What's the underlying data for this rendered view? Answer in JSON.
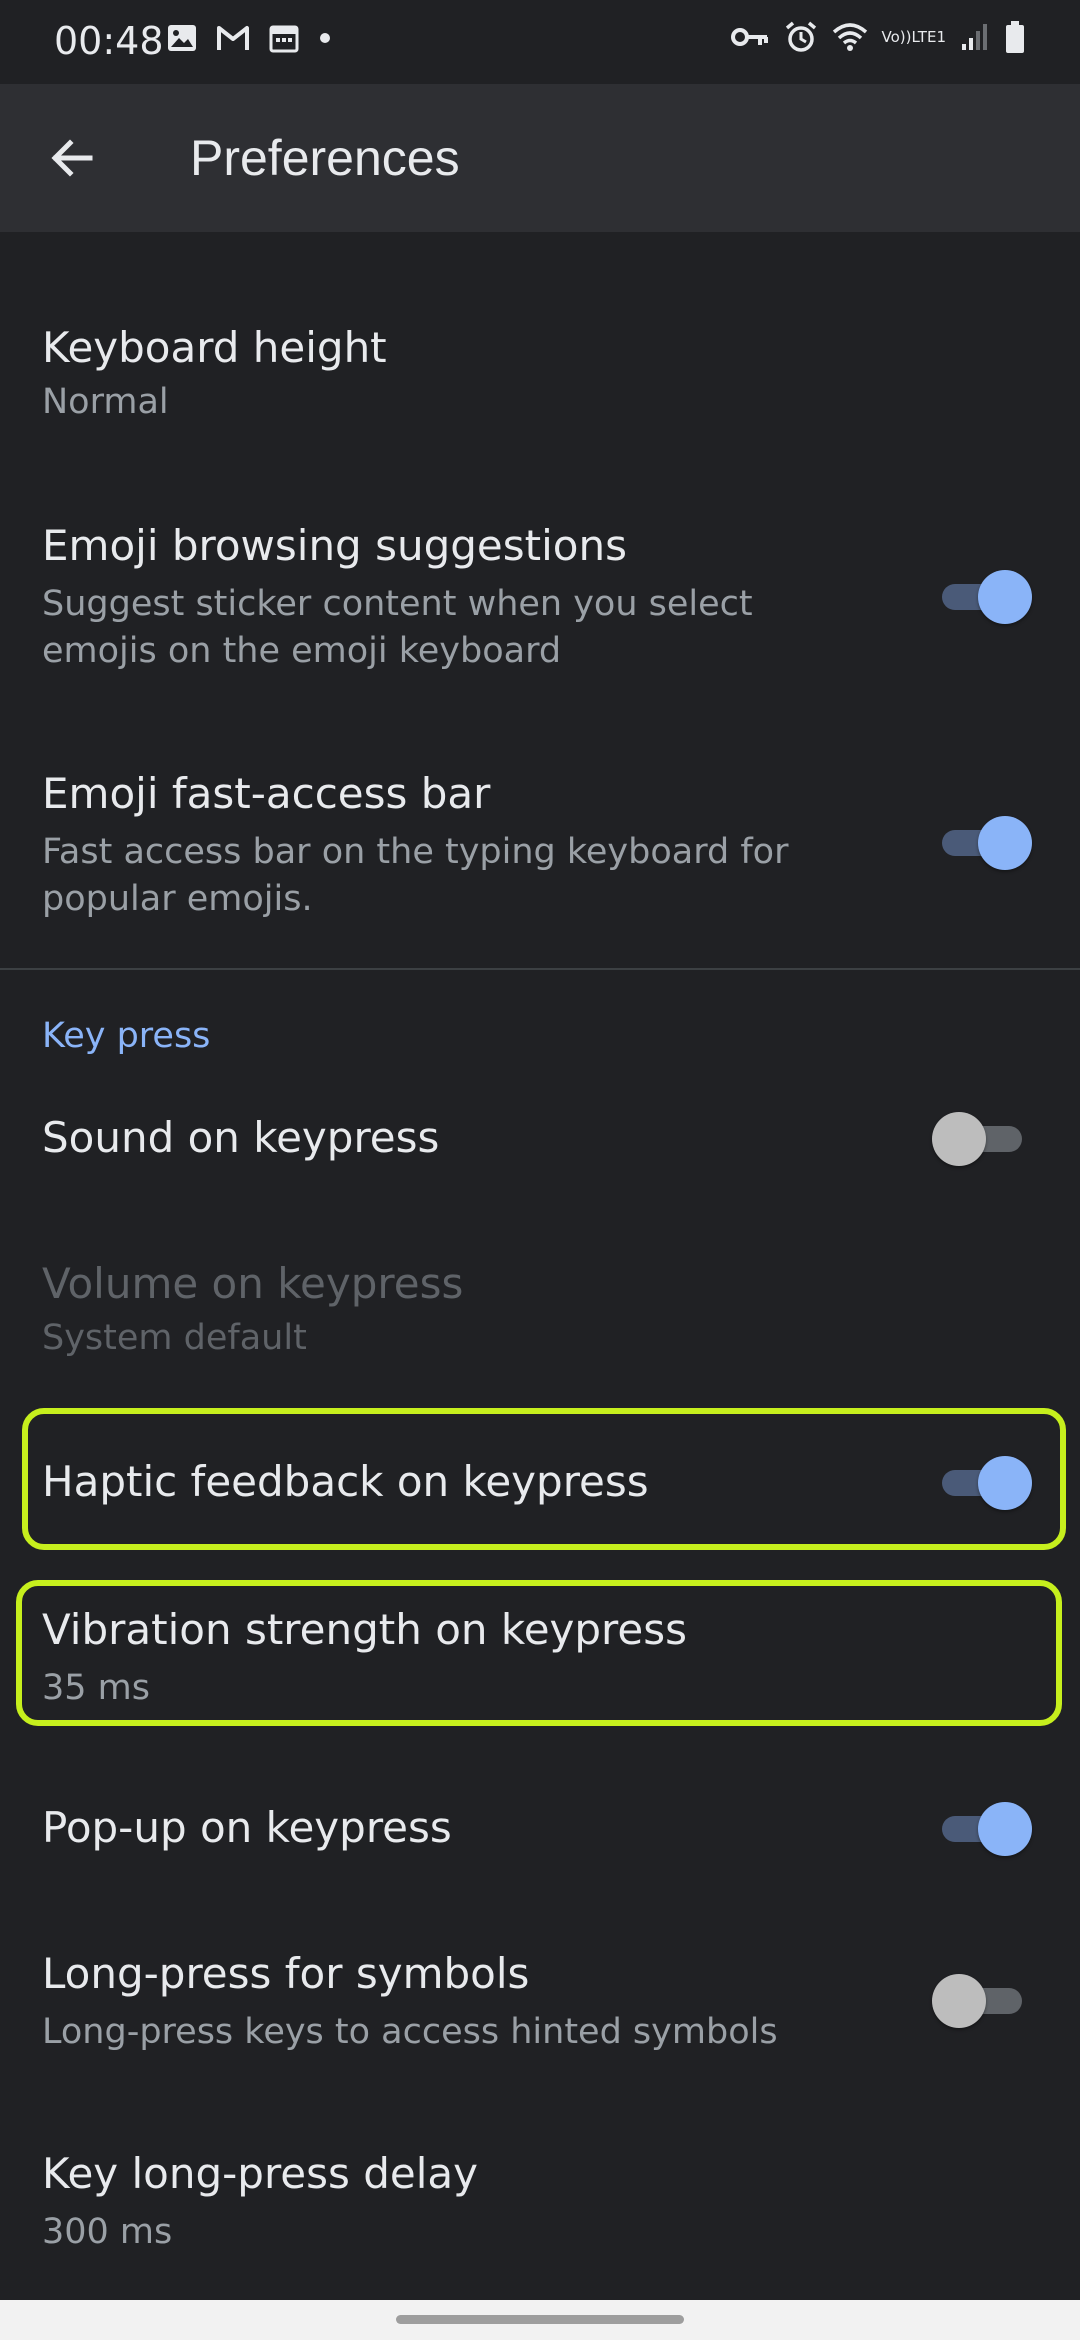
{
  "status_bar": {
    "time": "00:48",
    "left_icons": [
      "image-icon",
      "gmail-icon",
      "calendar-icon",
      "dot-icon"
    ],
    "right_icons": [
      "vpn-key-icon",
      "alarm-icon",
      "wifi-icon",
      "volte-icon",
      "signal-icon",
      "battery-icon"
    ],
    "network_top": "Vo))",
    "network_bottom": "LTE1"
  },
  "app_bar": {
    "back_icon": "arrow-back-icon",
    "title": "Preferences"
  },
  "preferences": {
    "keyboard_height": {
      "title": "Keyboard height",
      "summary": "Normal"
    },
    "emoji_browsing": {
      "title": "Emoji browsing suggestions",
      "summary_line1": "Suggest sticker content when you select",
      "summary_line2": "emojis on the emoji keyboard",
      "enabled": true
    },
    "emoji_fast_access": {
      "title": "Emoji fast-access bar",
      "summary_line1": "Fast access bar on the typing keyboard for",
      "summary_line2": "popular emojis.",
      "enabled": true
    }
  },
  "key_press": {
    "section_label": "Key press",
    "sound": {
      "title": "Sound on keypress",
      "enabled": false
    },
    "volume": {
      "title": "Volume on keypress",
      "summary": "System default"
    },
    "haptic": {
      "title": "Haptic feedback on keypress",
      "enabled": true
    },
    "vibration": {
      "title": "Vibration strength on keypress",
      "summary": "35 ms"
    },
    "popup": {
      "title": "Pop-up on keypress",
      "enabled": true
    },
    "long_press_symbols": {
      "title": "Long-press for symbols",
      "summary": "Long-press keys to access hinted symbols",
      "enabled": false
    },
    "long_press_delay": {
      "title": "Key long-press delay",
      "summary": "300 ms"
    }
  },
  "colors": {
    "background": "#202124",
    "app_bar": "#2e2f33",
    "accent": "#8ab4f8",
    "highlight": "#c6ef1d",
    "secondary_text": "#9aa0a6"
  }
}
